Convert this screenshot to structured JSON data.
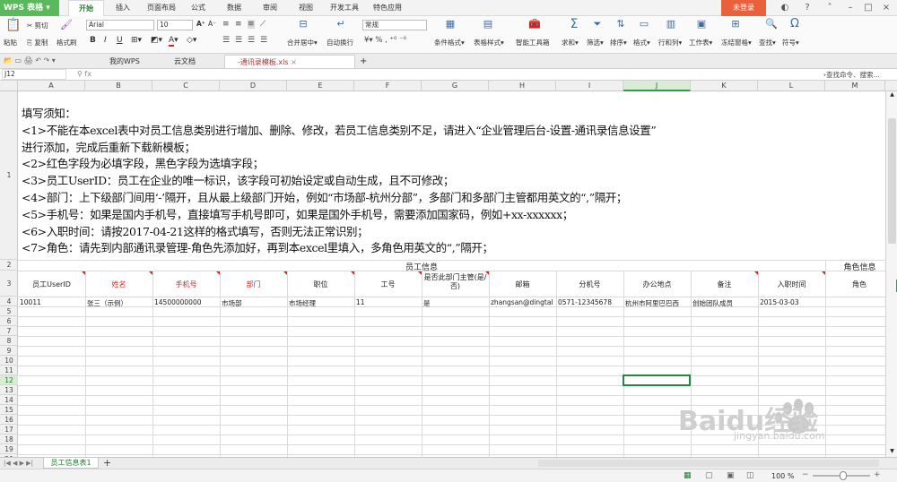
{
  "app": {
    "name": "WPS 表格",
    "login": "未登录"
  },
  "menu_tabs": [
    "开始",
    "插入",
    "页面布局",
    "公式",
    "数据",
    "审阅",
    "视图",
    "开发工具",
    "特色应用"
  ],
  "ribbon": {
    "paste": "粘贴",
    "cut": "剪切",
    "copy": "复制",
    "format_painter": "格式刷",
    "font_name": "Arial",
    "font_size": "10",
    "merge_center": "合并居中",
    "wrap": "自动换行",
    "number_format": "常规",
    "conditional_format": "条件格式",
    "table_style": "表格样式",
    "smart_toolbox": "智能工具箱",
    "sum": "求和",
    "filter": "筛选",
    "sort": "排序",
    "format": "格式",
    "rows_cols": "行和列",
    "worksheet": "工作表",
    "freeze": "冻结窗格",
    "find": "查找",
    "symbol": "符号"
  },
  "doc_tabs": [
    {
      "label": "我的WPS"
    },
    {
      "label": "云文档"
    },
    {
      "label": "-通讯录模板.xls"
    }
  ],
  "name_box": "J12",
  "search_cmd": "查找命令、搜索...",
  "columns": [
    "A",
    "B",
    "C",
    "D",
    "E",
    "F",
    "G",
    "H",
    "I",
    "J",
    "K",
    "L",
    "M"
  ],
  "selected_column": "J",
  "rows": [
    "1",
    "2",
    "3",
    "4",
    "5",
    "6",
    "7",
    "8",
    "9",
    "10",
    "11",
    "12",
    "13",
    "14",
    "15",
    "16",
    "17",
    "18",
    "19",
    "20",
    "21",
    "22",
    "23",
    "24",
    "25"
  ],
  "selected_row": "12",
  "notes": [
    "填写须知：",
    "<1>不能在本excel表中对员工信息类别进行增加、删除、修改，若员工信息类别不足，请进入“企业管理后台-设置-通讯录信息设置”",
    "进行添加，完成后重新下载新模板；",
    "<2>红色字段为必填字段，黑色字段为选填字段；",
    "<3>员工UserID：员工在企业的唯一标识，该字段可初始设定或自动生成，且不可修改；",
    "<4>部门：上下级部门间用‘-’隔开，且从最上级部门开始，例如“市场部-杭州分部”，多部门和多部门主管都用英文的“,”隔开；",
    "<5>手机号：如果是国内手机号，直接填写手机号即可，如果是国外手机号，需要添加国家码，例如+xx-xxxxxx；",
    "<6>入职时间：请按2017-04-21这样的格式填写，否则无法正常识别；",
    "<7>角色：请先到内部通讯录管理-角色先添加好，再到本excel里填入，多角色用英文的“,”隔开；"
  ],
  "group_headers": {
    "employee_info": "员工信息",
    "role_info": "角色信息"
  },
  "table_headers": [
    {
      "label": "员工UserID",
      "required": false
    },
    {
      "label": "姓名",
      "required": true
    },
    {
      "label": "手机号",
      "required": true
    },
    {
      "label": "部门",
      "required": true
    },
    {
      "label": "职位",
      "required": false
    },
    {
      "label": "工号",
      "required": false
    },
    {
      "label": "是否此部门主管(是/否)",
      "required": false
    },
    {
      "label": "邮箱",
      "required": false
    },
    {
      "label": "分机号",
      "required": false
    },
    {
      "label": "办公地点",
      "required": false
    },
    {
      "label": "备注",
      "required": false
    },
    {
      "label": "入职时间",
      "required": false
    },
    {
      "label": "角色",
      "required": false
    }
  ],
  "data_row": [
    "10011",
    "张三（示例）",
    "14500000000",
    "市场部",
    "市场经理",
    "11",
    "是",
    "zhangsan@dingtal",
    "0571-12345678",
    "杭州市阿里巴巴西",
    "创始团队成员",
    "2015-03-03",
    ""
  ],
  "sheet_tab": "员工信息表1",
  "zoom": "100 %",
  "watermark": {
    "text": "Baidu经验",
    "url": "jingyan.baidu.com"
  },
  "colors": {
    "accent_green": "#2f9e44",
    "required_red": "#d22222",
    "login_orange": "#e8603c"
  }
}
